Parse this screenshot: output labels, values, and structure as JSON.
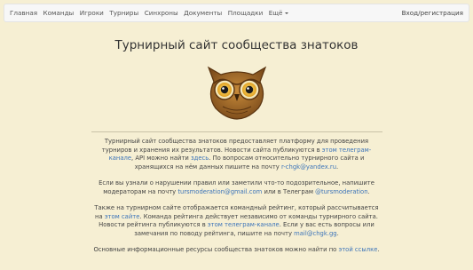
{
  "nav": {
    "items": [
      "Главная",
      "Команды",
      "Игроки",
      "Турниры",
      "Синхроны",
      "Документы",
      "Площадки"
    ],
    "more_label": "Ещё",
    "login_label": "Вход/регистрация"
  },
  "page": {
    "title": "Турнирный сайт сообщества знатоков"
  },
  "content": {
    "p1": {
      "t1": "Турнирный сайт сообщества знатоков предоставляет платформу для проведения турниров и хранения их результатов. Новости сайта публикуются в ",
      "l1": "этом телеграм-канале",
      "t2": ", API можно найти ",
      "l2": "здесь",
      "t3": ". По вопросам относительно турнирного сайта и хранящихся на нём данных пишите на почту ",
      "l3": "r-chgk@yandex.ru",
      "t4": "."
    },
    "p2": {
      "t1": "Если вы узнали о нарушении правил или заметили что-то подозрительное, напишите модераторам на почту ",
      "l1": "tursmoderation@gmail.com",
      "t2": " или в Телеграм ",
      "l2": "@tursmoderation",
      "t3": "."
    },
    "p3": {
      "t1": "Также на турнирном сайте отображается командный рейтинг, который рассчитывается на ",
      "l1": "этом сайте",
      "t2": ". Команда рейтинга действует независимо от команды турнирного сайта. Новости рейтинга публикуются в ",
      "l2": "этом телеграм-канале",
      "t3": ". Если у вас есть вопросы или замечания по поводу рейтинга, пишите на почту ",
      "l3": "mail@chgk.gg",
      "t4": "."
    },
    "p4": {
      "t1": "Основные информационные ресурсы сообщества знатоков можно найти по ",
      "l1": "этой ссылке",
      "t2": "."
    }
  },
  "colors": {
    "background": "#f6efd3",
    "link": "#3b73b9",
    "navbar": "#f7f7f7"
  },
  "icons": {
    "logo": "owl-logo"
  }
}
